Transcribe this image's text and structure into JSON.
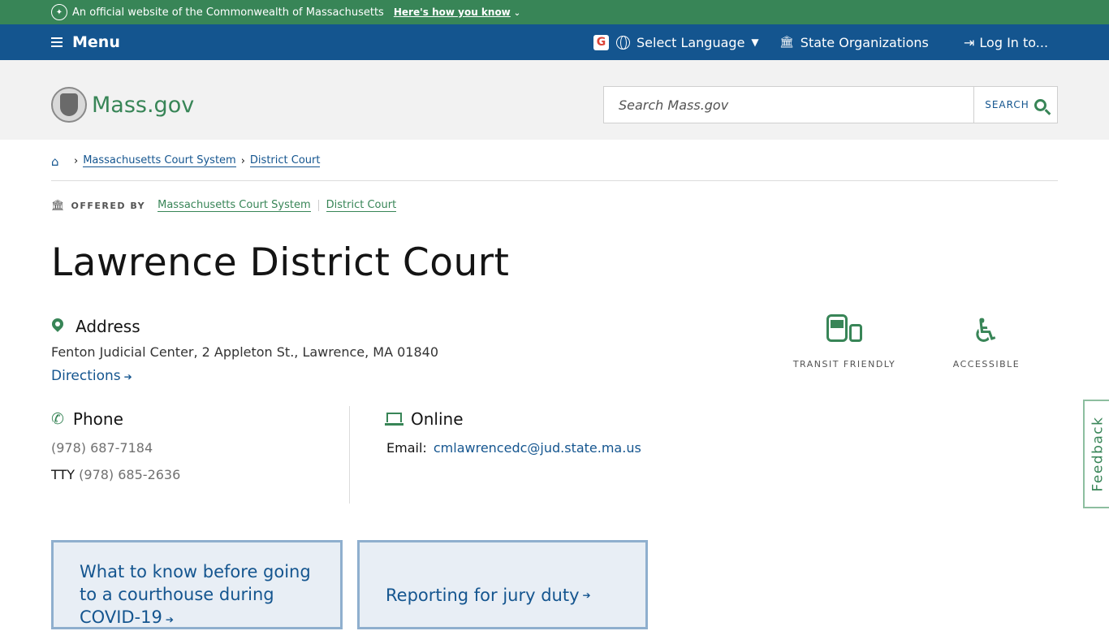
{
  "official_banner": {
    "text": "An official website of the Commonwealth of Massachusetts",
    "how_link": "Here's how you know"
  },
  "nav": {
    "menu_label": "Menu",
    "language_label": "Select Language",
    "orgs_label": "State Organizations",
    "login_label": "Log In to..."
  },
  "header": {
    "logo_text": "Mass.gov",
    "search_placeholder": "Search Mass.gov",
    "search_button": "SEARCH"
  },
  "breadcrumb": {
    "items": [
      "Massachusetts Court System",
      "District Court"
    ]
  },
  "offered_by": {
    "label": "OFFERED BY",
    "orgs": [
      "Massachusetts Court System",
      "District Court"
    ]
  },
  "page_title": "Lawrence District Court",
  "address": {
    "heading": "Address",
    "text": "Fenton Judicial Center, 2 Appleton St., Lawrence, MA 01840",
    "directions": "Directions"
  },
  "phone": {
    "heading": "Phone",
    "main": "(978) 687-7184",
    "tty_label": "TTY",
    "tty": "(978) 685-2636"
  },
  "online": {
    "heading": "Online",
    "email_label": "Email:",
    "email": "cmlawrencedc@jud.state.ma.us"
  },
  "badges": [
    "TRANSIT FRIENDLY",
    "ACCESSIBLE"
  ],
  "feedback_label": "Feedback",
  "tiles": [
    "What to know before going to a courthouse during COVID-19",
    "Reporting for jury duty"
  ],
  "colors": {
    "green": "#388557",
    "blue": "#14558f"
  }
}
